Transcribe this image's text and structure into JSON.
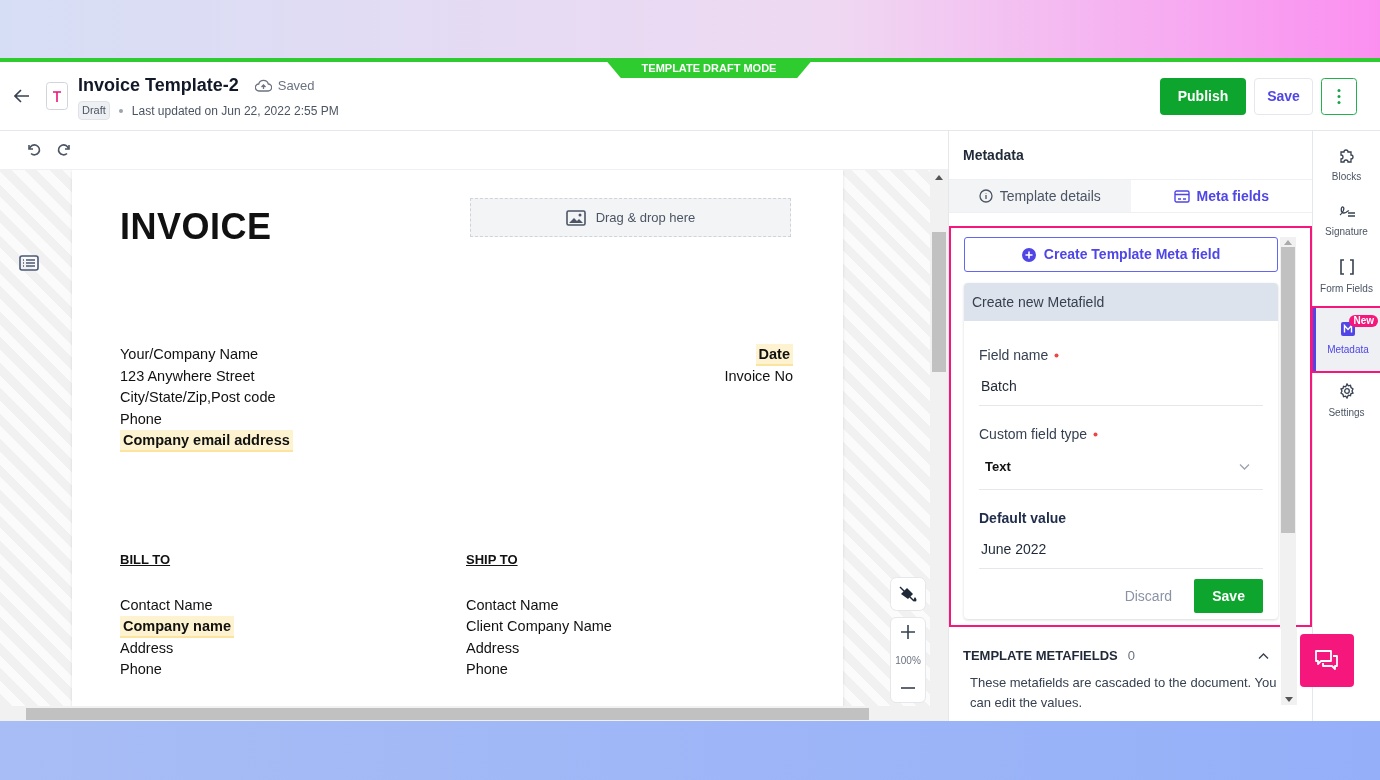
{
  "banner": {
    "label": "TEMPLATE DRAFT MODE"
  },
  "header": {
    "title": "Invoice Template-2",
    "save_status": "Saved",
    "status_badge": "Draft",
    "last_updated": "Last updated on Jun 22, 2022 2:55 PM",
    "buttons": [
      {
        "label": "Publish",
        "kind": "primary"
      },
      {
        "label": "Save",
        "kind": "secondary"
      }
    ]
  },
  "invoice": {
    "heading": "INVOICE",
    "image_drop": "Drag & drop here",
    "from_lines": [
      {
        "text": "Your/Company Name",
        "highlighted": false
      },
      {
        "text": "123 Anywhere Street",
        "highlighted": false
      },
      {
        "text": "City/State/Zip,Post code",
        "highlighted": false
      },
      {
        "text": "Phone",
        "highlighted": false
      },
      {
        "text": "Company email address",
        "highlighted": true
      }
    ],
    "info_lines": [
      {
        "text": "Date",
        "highlighted": true
      },
      {
        "text": "Invoice No",
        "highlighted": false
      }
    ],
    "columns": [
      {
        "heading": "BILL TO",
        "lines": [
          {
            "text": "Contact Name",
            "highlighted": false
          },
          {
            "text": "Company name",
            "highlighted": true
          },
          {
            "text": "Address",
            "highlighted": false
          },
          {
            "text": "Phone",
            "highlighted": false
          }
        ]
      },
      {
        "heading": "SHIP TO",
        "lines": [
          {
            "text": "Contact Name",
            "highlighted": false
          },
          {
            "text": "Client Company Name",
            "highlighted": false
          },
          {
            "text": "Address",
            "highlighted": false
          },
          {
            "text": "Phone",
            "highlighted": false
          }
        ]
      }
    ]
  },
  "zoom": {
    "reading": "100%"
  },
  "panel": {
    "title": "Metadata",
    "tabs": [
      {
        "label": "Template details",
        "selected": false,
        "kind": "info"
      },
      {
        "label": "Meta fields",
        "selected": true,
        "kind": "card"
      }
    ],
    "create_button": "Create Template Meta field",
    "form": {
      "title": "Create new Metafield",
      "fields": [
        {
          "label": "Field name",
          "required": true,
          "kind": "text",
          "value": "Batch"
        },
        {
          "label": "Custom field type",
          "required": true,
          "kind": "select",
          "value": "Text"
        },
        {
          "label": "Default value",
          "required": false,
          "kind": "text",
          "value": "June 2022"
        }
      ],
      "discard": "Discard",
      "save": "Save"
    },
    "metafields": {
      "title": "TEMPLATE METAFIELDS",
      "count": "0",
      "expanded": true,
      "description": "These metafields are cascaded to the document. You can edit the values."
    }
  },
  "rail": [
    {
      "label": "Blocks",
      "kind": "blocks",
      "selected": false
    },
    {
      "label": "Signature",
      "kind": "signature",
      "selected": false
    },
    {
      "label": "Form Fields",
      "kind": "brackets",
      "selected": false
    },
    {
      "label": "Metadata",
      "kind": "metadata",
      "selected": true,
      "badge": "New"
    },
    {
      "label": "Settings",
      "kind": "settings",
      "selected": false
    }
  ]
}
